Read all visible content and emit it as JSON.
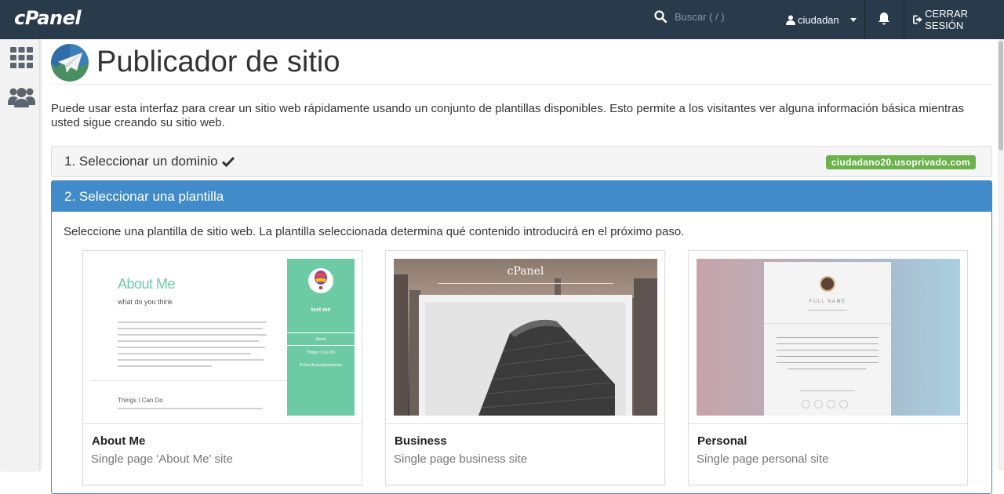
{
  "header": {
    "logo": "cPanel",
    "search_placeholder": "Buscar ( / )",
    "username": "ciudadan",
    "logout_label": "CERRAR SESIÓN"
  },
  "sidebar": {
    "icons": [
      "grid-icon",
      "users-icon"
    ]
  },
  "page": {
    "title": "Publicador de sitio",
    "description": "Puede usar esta interfaz para crear un sitio web rápidamente usando un conjunto de plantillas disponibles. Esto permite a los visitantes ver alguna información básica mientras usted sigue creando su sitio web."
  },
  "step1": {
    "label": "1. Seleccionar un dominio",
    "domain": "ciudadano20.usoprivado.com"
  },
  "step2": {
    "label": "2. Seleccionar una plantilla",
    "description": "Seleccione una plantilla de sitio web. La plantilla seleccionada determina qué contenido introducirá en el próximo paso.",
    "templates": [
      {
        "name": "About Me",
        "description": "Single page 'About Me' site",
        "preview": {
          "heading": "About Me",
          "tagline": "what do you think",
          "section": "Things I Can Do",
          "side_name": "test me",
          "side_links": [
            "About",
            "Things I Can Do",
            "A Few Accomplishments"
          ]
        }
      },
      {
        "name": "Business",
        "description": "Single page business site",
        "preview": {
          "brand": "cPanel"
        }
      },
      {
        "name": "Personal",
        "description": "Single page personal site",
        "preview": {
          "full_name": "FULL NAME"
        }
      }
    ]
  },
  "colors": {
    "topbar": "#293a4a",
    "accent": "#428bca",
    "badge": "#6bb24a",
    "mint": "#6ccba5"
  }
}
